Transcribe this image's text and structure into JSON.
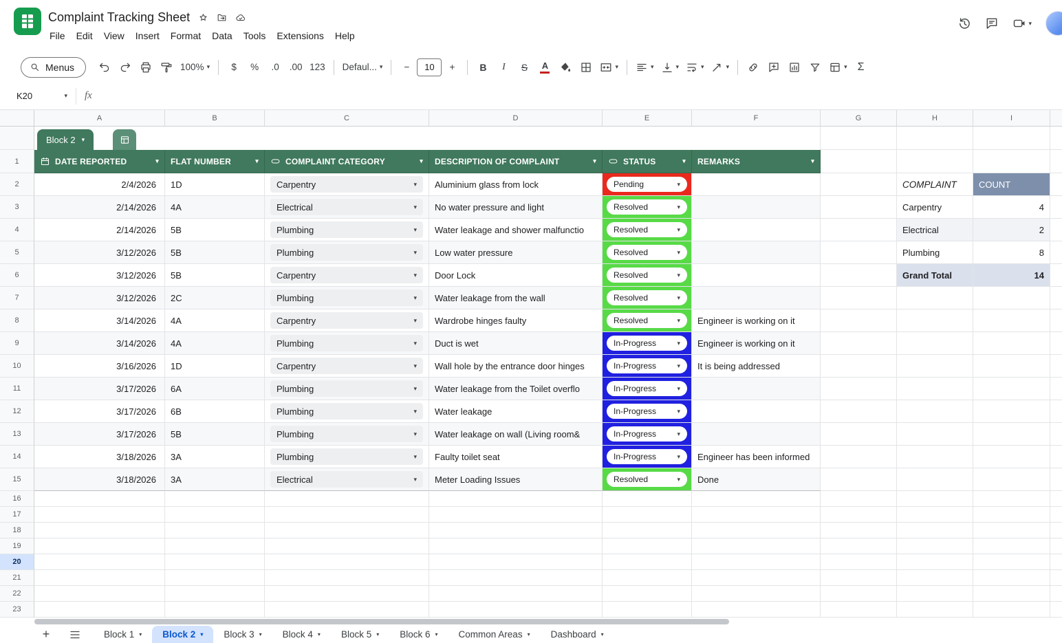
{
  "app": {
    "title": "Complaint Tracking Sheet",
    "menus": [
      "File",
      "Edit",
      "View",
      "Insert",
      "Format",
      "Data",
      "Tools",
      "Extensions",
      "Help"
    ],
    "name_box": "K20",
    "fx_label": "fx"
  },
  "toolbar": {
    "menus_label": "Menus",
    "zoom": "100%",
    "currency": "$",
    "percent": "%",
    "decrease_decimal": ".0",
    "increase_decimal": ".00",
    "number_format": "123",
    "font_name": "Defaul...",
    "font_size": "10",
    "minus": "−",
    "plus": "+",
    "bold": "B",
    "italic": "I",
    "strikethrough": "S",
    "text_color": "A",
    "functions": "Σ"
  },
  "grid": {
    "table_chip": "Block 2",
    "col_letters": [
      "A",
      "B",
      "C",
      "D",
      "E",
      "F",
      "G",
      "H",
      "I"
    ],
    "row_numbers": [
      "1",
      "2",
      "3",
      "4",
      "5",
      "6",
      "7",
      "8",
      "9",
      "10",
      "11",
      "12",
      "13",
      "14",
      "15",
      "16",
      "17",
      "18",
      "19",
      "20",
      "21",
      "22",
      "23"
    ],
    "selected_row": "20"
  },
  "table": {
    "headers": {
      "date": "DATE REPORTED",
      "flat": "FLAT NUMBER",
      "category": "COMPLAINT CATEGORY",
      "description": "DESCRIPTION OF COMPLAINT",
      "status": "STATUS",
      "remarks": "REMARKS"
    },
    "rows": [
      {
        "date": "2/4/2026",
        "flat": "1D",
        "category": "Carpentry",
        "description": "Aluminium glass from lock",
        "status": "Pending",
        "remarks": ""
      },
      {
        "date": "2/14/2026",
        "flat": "4A",
        "category": "Electrical",
        "description": "No water pressure and light",
        "status": "Resolved",
        "remarks": ""
      },
      {
        "date": "2/14/2026",
        "flat": "5B",
        "category": "Plumbing",
        "description": "Water leakage and shower malfunctio",
        "status": "Resolved",
        "remarks": ""
      },
      {
        "date": "3/12/2026",
        "flat": "5B",
        "category": "Plumbing",
        "description": "Low water pressure",
        "status": "Resolved",
        "remarks": ""
      },
      {
        "date": "3/12/2026",
        "flat": "5B",
        "category": "Carpentry",
        "description": "Door Lock",
        "status": "Resolved",
        "remarks": ""
      },
      {
        "date": "3/12/2026",
        "flat": "2C",
        "category": "Plumbing",
        "description": "Water leakage from the wall",
        "status": "Resolved",
        "remarks": ""
      },
      {
        "date": "3/14/2026",
        "flat": "4A",
        "category": "Carpentry",
        "description": "Wardrobe hinges faulty",
        "status": "Resolved",
        "remarks": "Engineer is working on it"
      },
      {
        "date": "3/14/2026",
        "flat": "4A",
        "category": "Plumbing",
        "description": "Duct is wet",
        "status": "In-Progress",
        "remarks": "Engineer is working on it"
      },
      {
        "date": "3/16/2026",
        "flat": "1D",
        "category": "Carpentry",
        "description": "Wall hole by the entrance door hinges",
        "status": "In-Progress",
        "remarks": "It is being addressed"
      },
      {
        "date": "3/17/2026",
        "flat": "6A",
        "category": "Plumbing",
        "description": "Water leakage from the Toilet overflo",
        "status": "In-Progress",
        "remarks": ""
      },
      {
        "date": "3/17/2026",
        "flat": "6B",
        "category": "Plumbing",
        "description": "Water leakage",
        "status": "In-Progress",
        "remarks": ""
      },
      {
        "date": "3/17/2026",
        "flat": "5B",
        "category": "Plumbing",
        "description": "Water leakage on wall (Living room&",
        "status": "In-Progress",
        "remarks": ""
      },
      {
        "date": "3/18/2026",
        "flat": "3A",
        "category": "Plumbing",
        "description": "Faulty toilet seat",
        "status": "In-Progress",
        "remarks": "Engineer has been informed"
      },
      {
        "date": "3/18/2026",
        "flat": "3A",
        "category": "Electrical",
        "description": "Meter Loading Issues",
        "status": "Resolved",
        "remarks": "Done"
      }
    ]
  },
  "summary": {
    "header_complaint": "COMPLAINT",
    "header_count": "COUNT",
    "rows": [
      {
        "name": "Carpentry",
        "count": "4"
      },
      {
        "name": "Electrical",
        "count": "2"
      },
      {
        "name": "Plumbing",
        "count": "8"
      }
    ],
    "total_label": "Grand Total",
    "total_count": "14"
  },
  "tabs": {
    "items": [
      "Block 1",
      "Block 2",
      "Block 3",
      "Block 4",
      "Block 5",
      "Block 6",
      "Common Areas",
      "Dashboard"
    ],
    "active": "Block 2"
  },
  "colors": {
    "table_header_green": "#40795d",
    "status_pending_red": "#e9291d",
    "status_resolved_green": "#58da47",
    "status_inprogress_blue": "#2020e0",
    "count_header_slate": "#7d8fab",
    "active_tab_blue": "#0b57d0",
    "selected_row_highlight": "#d3e3fd"
  }
}
